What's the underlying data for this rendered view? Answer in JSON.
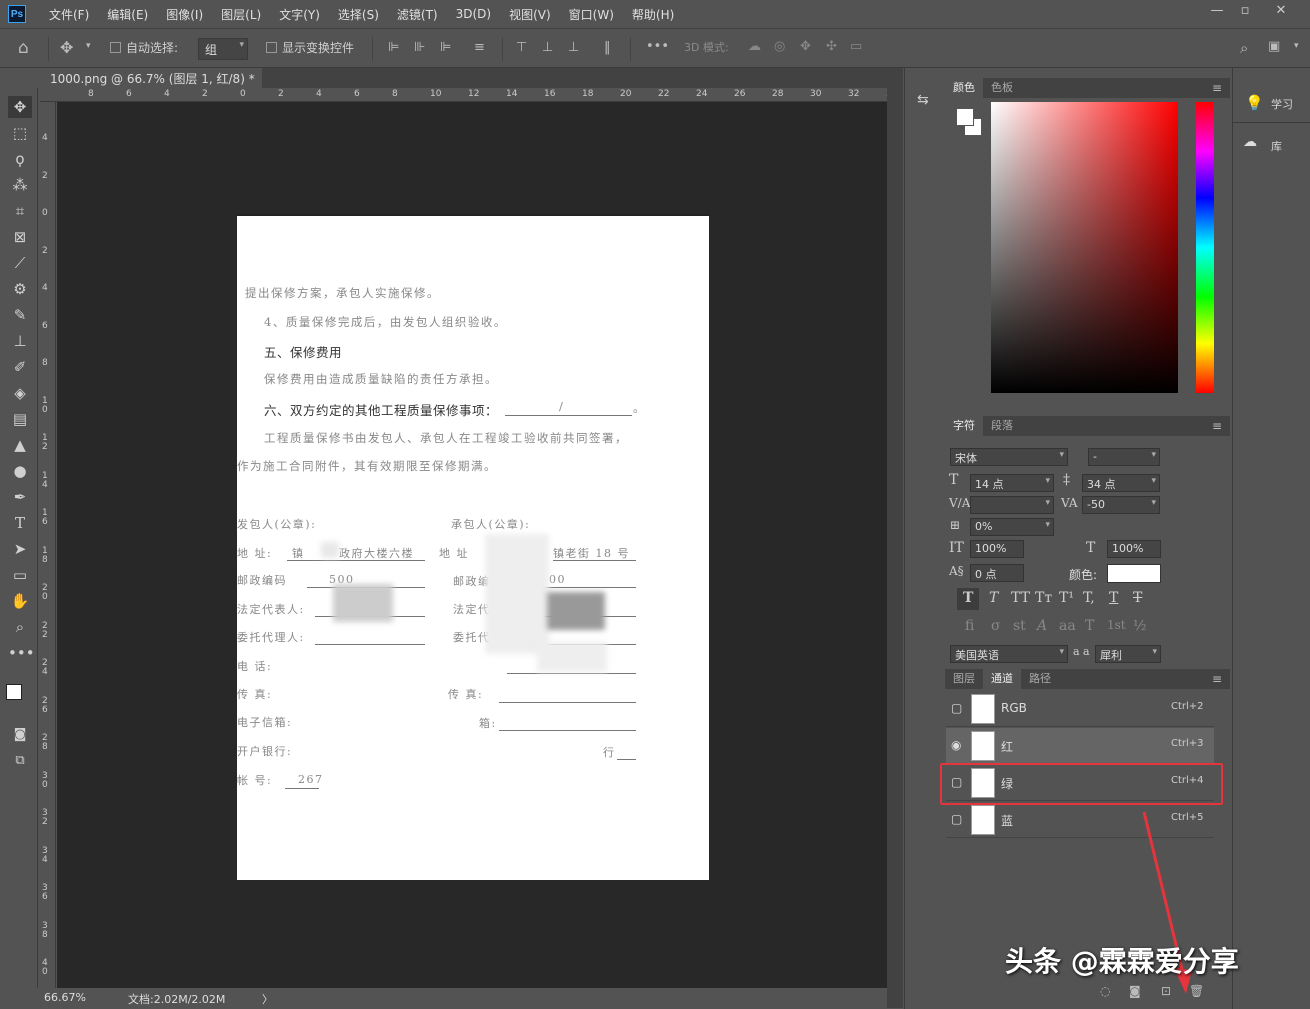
{
  "app": {
    "logo": "Ps"
  },
  "menu": [
    "文件(F)",
    "编辑(E)",
    "图像(I)",
    "图层(L)",
    "文字(Y)",
    "选择(S)",
    "滤镜(T)",
    "3D(D)",
    "视图(V)",
    "窗口(W)",
    "帮助(H)"
  ],
  "options": {
    "auto_select_label": "自动选择:",
    "auto_select_value": "组",
    "show_transform_label": "显示变换控件",
    "mode_3d_label": "3D 模式:",
    "more": "•••"
  },
  "tab": {
    "title": "1000.png @ 66.7% (图层 1, 红/8) *",
    "close": "×"
  },
  "ruler": {
    "h": [
      "8",
      "6",
      "4",
      "2",
      "0",
      "2",
      "4",
      "6",
      "8",
      "10",
      "12",
      "14",
      "16",
      "18",
      "20",
      "22",
      "24",
      "26",
      "28",
      "30",
      "32",
      "3"
    ],
    "v": [
      "4",
      "2",
      "0",
      "2",
      "4",
      "6",
      "8",
      "1 0",
      "1 2",
      "1 4",
      "1 6",
      "1 8",
      "2 0",
      "2 2",
      "2 4",
      "2 6",
      "2 8",
      "3 0",
      "3 2",
      "3 4",
      "3 6",
      "3 8",
      "4 0"
    ]
  },
  "document": {
    "lines": [
      "提出保修方案，承包人实施保修。",
      "4、质量保修完成后，由发包人组织验收。",
      "五、保修费用",
      "保修费用由造成质量缺陷的责任方承担。",
      "六、双方约定的其他工程质量保修事项：",
      "工程质量保修书由发包人、承包人在工程竣工验收前共同签署，",
      "作为施工合同附件，其有效期限至保修期满。"
    ],
    "slash": "/",
    "period": "。",
    "left": [
      "发包人(公章):",
      "地   址:",
      "邮政编码",
      "法定代表人:",
      "委托代理人:",
      "电   话:",
      "传   真:",
      "电子信箱:",
      "开户银行:",
      "帐   号:"
    ],
    "right": [
      "承包人(公章):",
      "地   址",
      "邮政编码:",
      "法定代表人:",
      "委托代理人:",
      "传   真:",
      "箱:",
      "行"
    ],
    "left_values": [
      "镇",
      "政府大楼六楼",
      "500",
      "267"
    ],
    "right_values": [
      "镇老街 18 号",
      "00"
    ]
  },
  "status": {
    "zoom": "66.67%",
    "doc": "文档:2.02M/2.02M",
    "arrow": "〉"
  },
  "color_panel": {
    "tabs": [
      "颜色",
      "色板"
    ]
  },
  "char_panel": {
    "tabs": [
      "字符",
      "段落"
    ],
    "font": "宋体",
    "style": "-",
    "size": "14 点",
    "leading": "34 点",
    "kerning": "",
    "tracking": "-50",
    "scale_pct": "0%",
    "vscale": "100%",
    "hscale": "100%",
    "baseline": "0 点",
    "color_label": "颜色:",
    "language": "美国英语",
    "aa_label": "a a",
    "antialias": "犀利",
    "style_glyphs": [
      "T",
      "T",
      "TT",
      "Tт",
      "T¹",
      "T,",
      "T",
      "T"
    ],
    "ot_glyphs": [
      "fi",
      "σ",
      "st",
      "A",
      "aa",
      "T",
      "1st",
      "½"
    ]
  },
  "channels_panel": {
    "tabs": [
      "图层",
      "通道",
      "路径"
    ],
    "rows": [
      {
        "name": "RGB",
        "key": "Ctrl+2"
      },
      {
        "name": "红",
        "key": "Ctrl+3"
      },
      {
        "name": "绿",
        "key": "Ctrl+4"
      },
      {
        "name": "蓝",
        "key": "Ctrl+5"
      }
    ]
  },
  "learn": {
    "learn_label": "学习",
    "lib_label": "库"
  },
  "watermark": "头条 @霖霖爱分享",
  "colors": {
    "highlight": "#e5343b",
    "bg": "#535353",
    "canvas": "#282828"
  }
}
